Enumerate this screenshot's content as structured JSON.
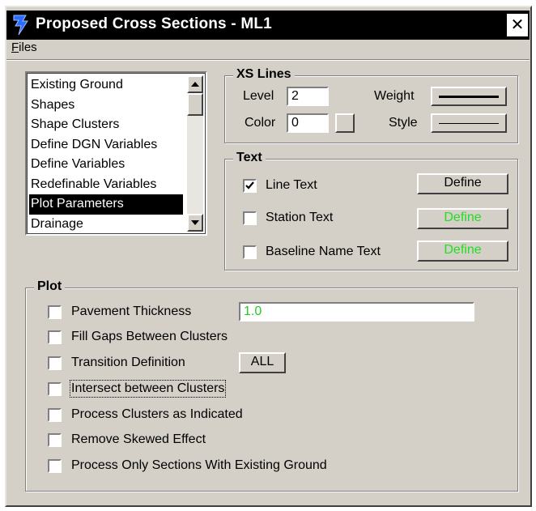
{
  "window": {
    "title": "Proposed Cross Sections - ML1",
    "close_glyph": "✕",
    "app_icon": "bentley-b-icon"
  },
  "menubar": {
    "files_first": "F",
    "files_rest": "iles"
  },
  "list": {
    "items": [
      {
        "label": "Existing Ground",
        "selected": false
      },
      {
        "label": "Shapes",
        "selected": false
      },
      {
        "label": "Shape Clusters",
        "selected": false
      },
      {
        "label": "Define DGN Variables",
        "selected": false
      },
      {
        "label": "Define Variables",
        "selected": false
      },
      {
        "label": "Redefinable Variables",
        "selected": false
      },
      {
        "label": "Plot Parameters",
        "selected": true
      },
      {
        "label": "Drainage",
        "selected": false
      }
    ]
  },
  "xs_lines": {
    "title": "XS Lines",
    "level_label": "Level",
    "level_value": "2",
    "color_label": "Color",
    "color_value": "0",
    "weight_label": "Weight",
    "style_label": "Style"
  },
  "text": {
    "title": "Text",
    "rows": [
      {
        "label": "Line Text",
        "checked": true,
        "button": "Define",
        "button_color": "#000000"
      },
      {
        "label": "Station Text",
        "checked": false,
        "button": "Define",
        "button_color": "#22dd22"
      },
      {
        "label": "Baseline Name Text",
        "checked": false,
        "button": "Define",
        "button_color": "#22dd22"
      }
    ]
  },
  "plot": {
    "title": "Plot",
    "pavement_label": "Pavement Thickness",
    "pavement_value": "1.0",
    "fill_gaps_label": "Fill Gaps Between Clusters",
    "transition_label": "Transition Definition",
    "transition_button": "ALL",
    "intersect_label": "Intersect between Clusters",
    "process_clusters_label": "Process Clusters as Indicated",
    "remove_skew_label": "Remove Skewed Effect",
    "process_only_label": "Process Only Sections With Existing Ground",
    "checked": [
      false,
      false,
      false,
      false,
      false,
      false,
      false
    ]
  }
}
